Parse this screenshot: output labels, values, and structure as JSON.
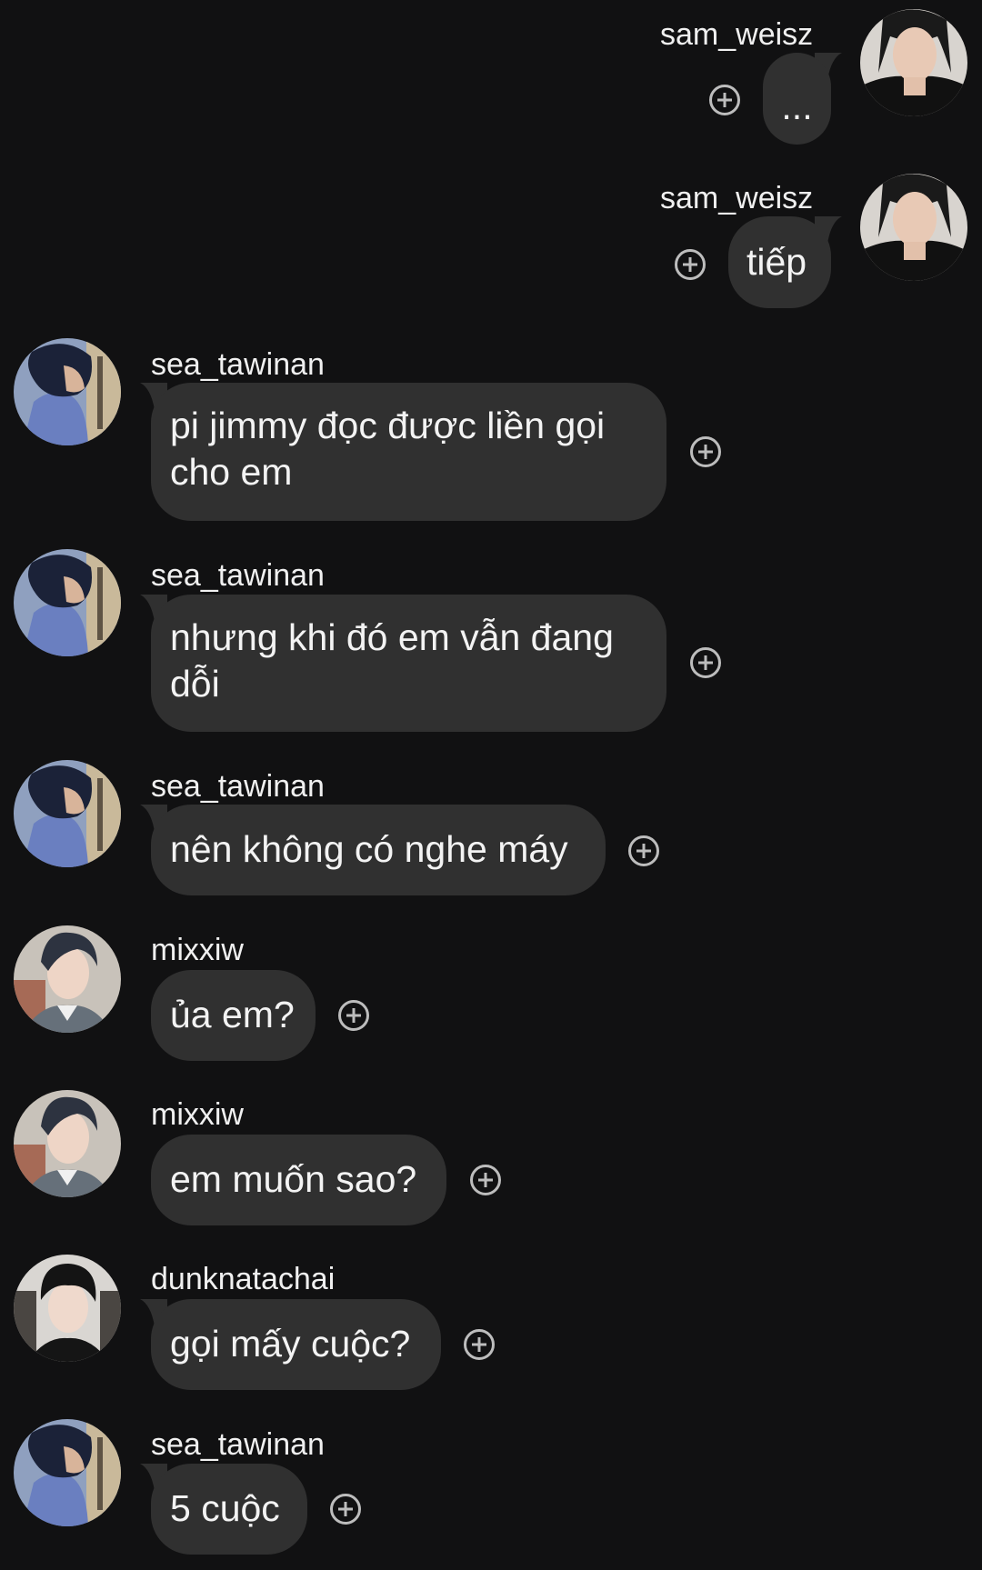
{
  "messages": [
    {
      "sender": "sam_weisz",
      "text": "...",
      "side": "right"
    },
    {
      "sender": "sam_weisz",
      "text": "tiếp",
      "side": "right"
    },
    {
      "sender": "sea_tawinan",
      "text": "pi jimmy đọc được liền gọi cho em",
      "side": "left"
    },
    {
      "sender": "sea_tawinan",
      "text": "nhưng khi đó em vẫn đang dỗi",
      "side": "left"
    },
    {
      "sender": "sea_tawinan",
      "text": "nên không có nghe máy",
      "side": "left"
    },
    {
      "sender": "mixxiw",
      "text": "ủa em?",
      "side": "left"
    },
    {
      "sender": "mixxiw",
      "text": "em muốn sao?",
      "side": "left"
    },
    {
      "sender": "dunknatachai",
      "text": "gọi mấy cuộc?",
      "side": "left"
    },
    {
      "sender": "sea_tawinan",
      "text": "5 cuộc",
      "side": "left"
    }
  ],
  "icons": {
    "reaction": "add-reaction-icon",
    "avatar": "user-avatar"
  },
  "colors": {
    "background": "#111112",
    "bubble": "#303030",
    "text": "#f3f3f3",
    "icon": "#bdbdbd"
  }
}
